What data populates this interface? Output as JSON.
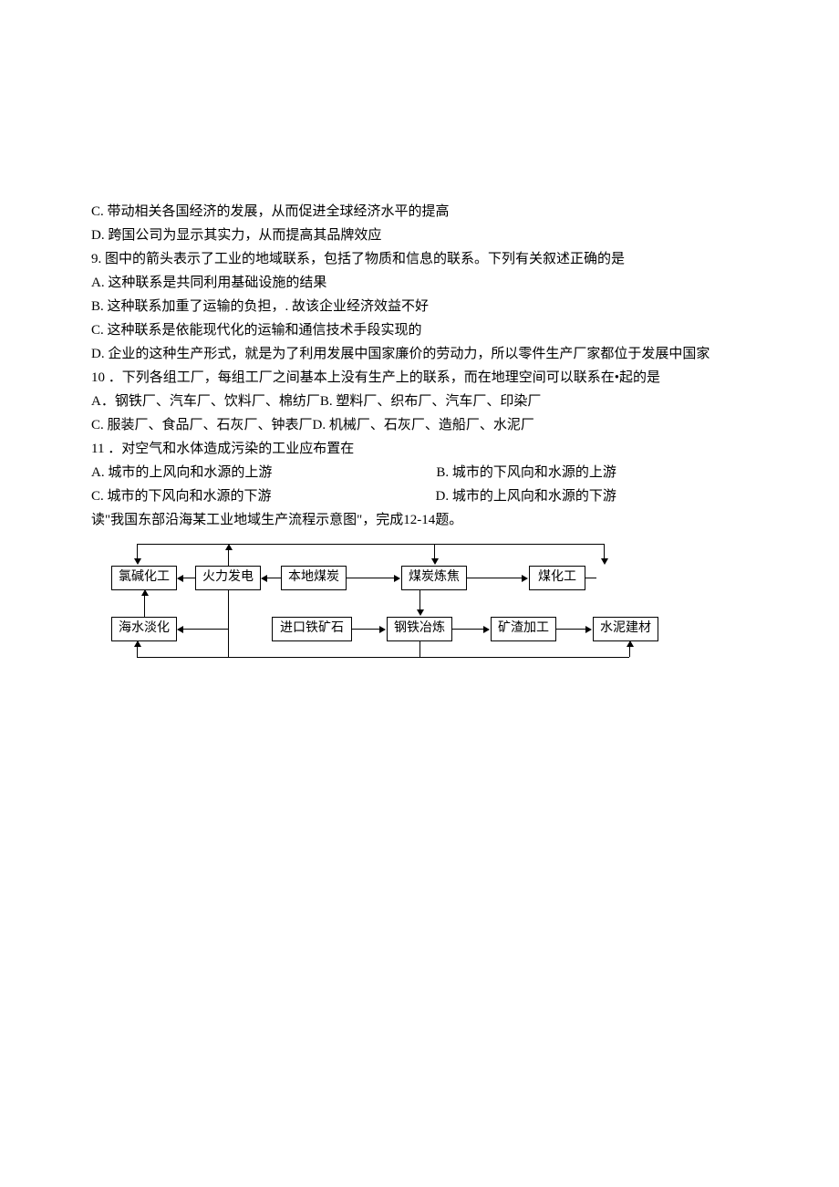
{
  "lines": {
    "c": "C. 带动相关各国经济的发展，从而促进全球经济水平的提高",
    "d": "D. 跨国公司为显示其实力，从而提高其品牌效应",
    "q9": "9. 图中的箭头表示了工业的地域联系，包括了物质和信息的联系。下列有关叙述正确的是",
    "q9a": "A. 这种联系是共同利用基础设施的结果",
    "q9b": "B. 这种联系加重了运输的负担，. 故该企业经济效益不好",
    "q9c": "C. 这种联系是依能现代化的运输和通信技术手段实现的",
    "q9d": "D. 企业的这种生产形式，就是为了利用发展中国家廉价的劳动力，所以零件生产厂家都位于发展中国家",
    "q10": "10 ．下列各组工厂，每组工厂之间基本上没有生产上的联系，而在地理空间可以联系在•起的是",
    "q10a": " A．钢铁厂、汽车厂、饮料厂、棉纺厂B. 塑料厂、织布厂、汽车厂、印染厂",
    "q10cd": "C. 服装厂、食品厂、石灰厂、钟表厂D. 机械厂、石灰厂、造船厂、水泥厂",
    "q11": "11 ．对空气和水体造成污染的工业应布置在",
    "q11a": "A. 城市的上风向和水源的上游",
    "q11b": "B. 城市的下风向和水源的上游",
    "q11c": "C. 城市的下风向和水源的下游",
    "q11d": "D. 城市的上风向和水源的下游",
    "instr": "读\"我国东部沿海某工业地域生产流程示意图\"，完成12-14题。"
  },
  "chart_data": {
    "type": "diagram",
    "title": "我国东部沿海某工业地域生产流程示意图",
    "nodes": [
      {
        "id": "n1",
        "label": "氯碱化工"
      },
      {
        "id": "n2",
        "label": "火力发电"
      },
      {
        "id": "n3",
        "label": "本地煤炭"
      },
      {
        "id": "n4",
        "label": "煤炭炼焦"
      },
      {
        "id": "n5",
        "label": "煤化工"
      },
      {
        "id": "n6",
        "label": "海水淡化"
      },
      {
        "id": "n7",
        "label": "进口铁矿石"
      },
      {
        "id": "n8",
        "label": "钢铁冶炼"
      },
      {
        "id": "n9",
        "label": "矿渣加工"
      },
      {
        "id": "n10",
        "label": "水泥建材"
      }
    ],
    "edges": [
      {
        "from": "n3",
        "to": "n2"
      },
      {
        "from": "n3",
        "to": "n4"
      },
      {
        "from": "n4",
        "to": "n5"
      },
      {
        "from": "n2",
        "to": "n1"
      },
      {
        "from": "n2",
        "to": "n6"
      },
      {
        "from": "n6",
        "to": "n1"
      },
      {
        "from": "n7",
        "to": "n8"
      },
      {
        "from": "n4",
        "to": "n8"
      },
      {
        "from": "n8",
        "to": "n9"
      },
      {
        "from": "n9",
        "to": "n10"
      },
      {
        "from": "n2",
        "to": "n8"
      },
      {
        "from": "bus_top",
        "to": "n1"
      },
      {
        "from": "n2",
        "to": "bus_top"
      },
      {
        "from": "bus_top",
        "to": "n4"
      },
      {
        "from": "bus_top",
        "to": "n5"
      },
      {
        "from": "n8",
        "to": "bus_bottom"
      },
      {
        "from": "bus_bottom",
        "to": "n6"
      },
      {
        "from": "bus_bottom",
        "to": "n10"
      }
    ]
  }
}
